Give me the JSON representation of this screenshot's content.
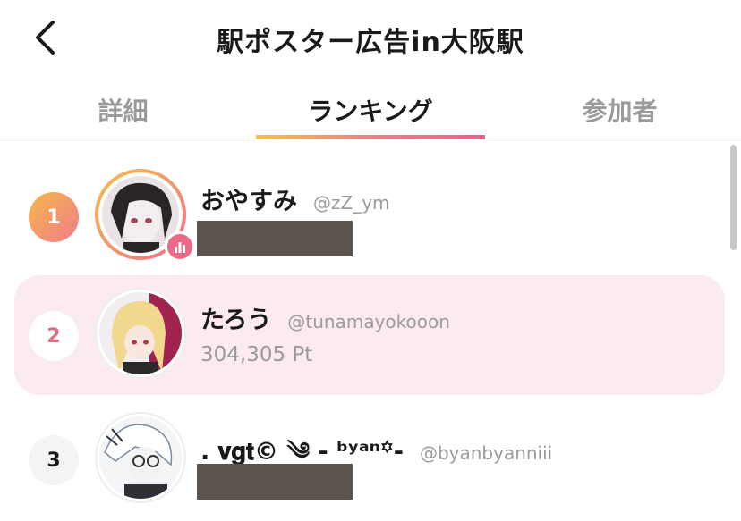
{
  "header": {
    "title": "駅ポスター広告in大阪駅"
  },
  "tabs": [
    {
      "label": "詳細"
    },
    {
      "label": "ランキング"
    },
    {
      "label": "参加者"
    }
  ],
  "ranking": [
    {
      "rank": "1",
      "name": "おやすみ",
      "handle": "@zZ_ym",
      "points": null
    },
    {
      "rank": "2",
      "name": "たろう",
      "handle": "@tunamayokooon",
      "points": "304,305 Pt"
    },
    {
      "rank": "3",
      "name": ". 𝐯𝐠𝐭© ༄ - ᵇʸᵃⁿ꙳-",
      "handle": "@byanbyanniii",
      "points": null
    }
  ],
  "colors": {
    "accent_pink": "#ec6a86",
    "accent_gold": "#f3c14a",
    "highlight_row": "#fcebee"
  }
}
